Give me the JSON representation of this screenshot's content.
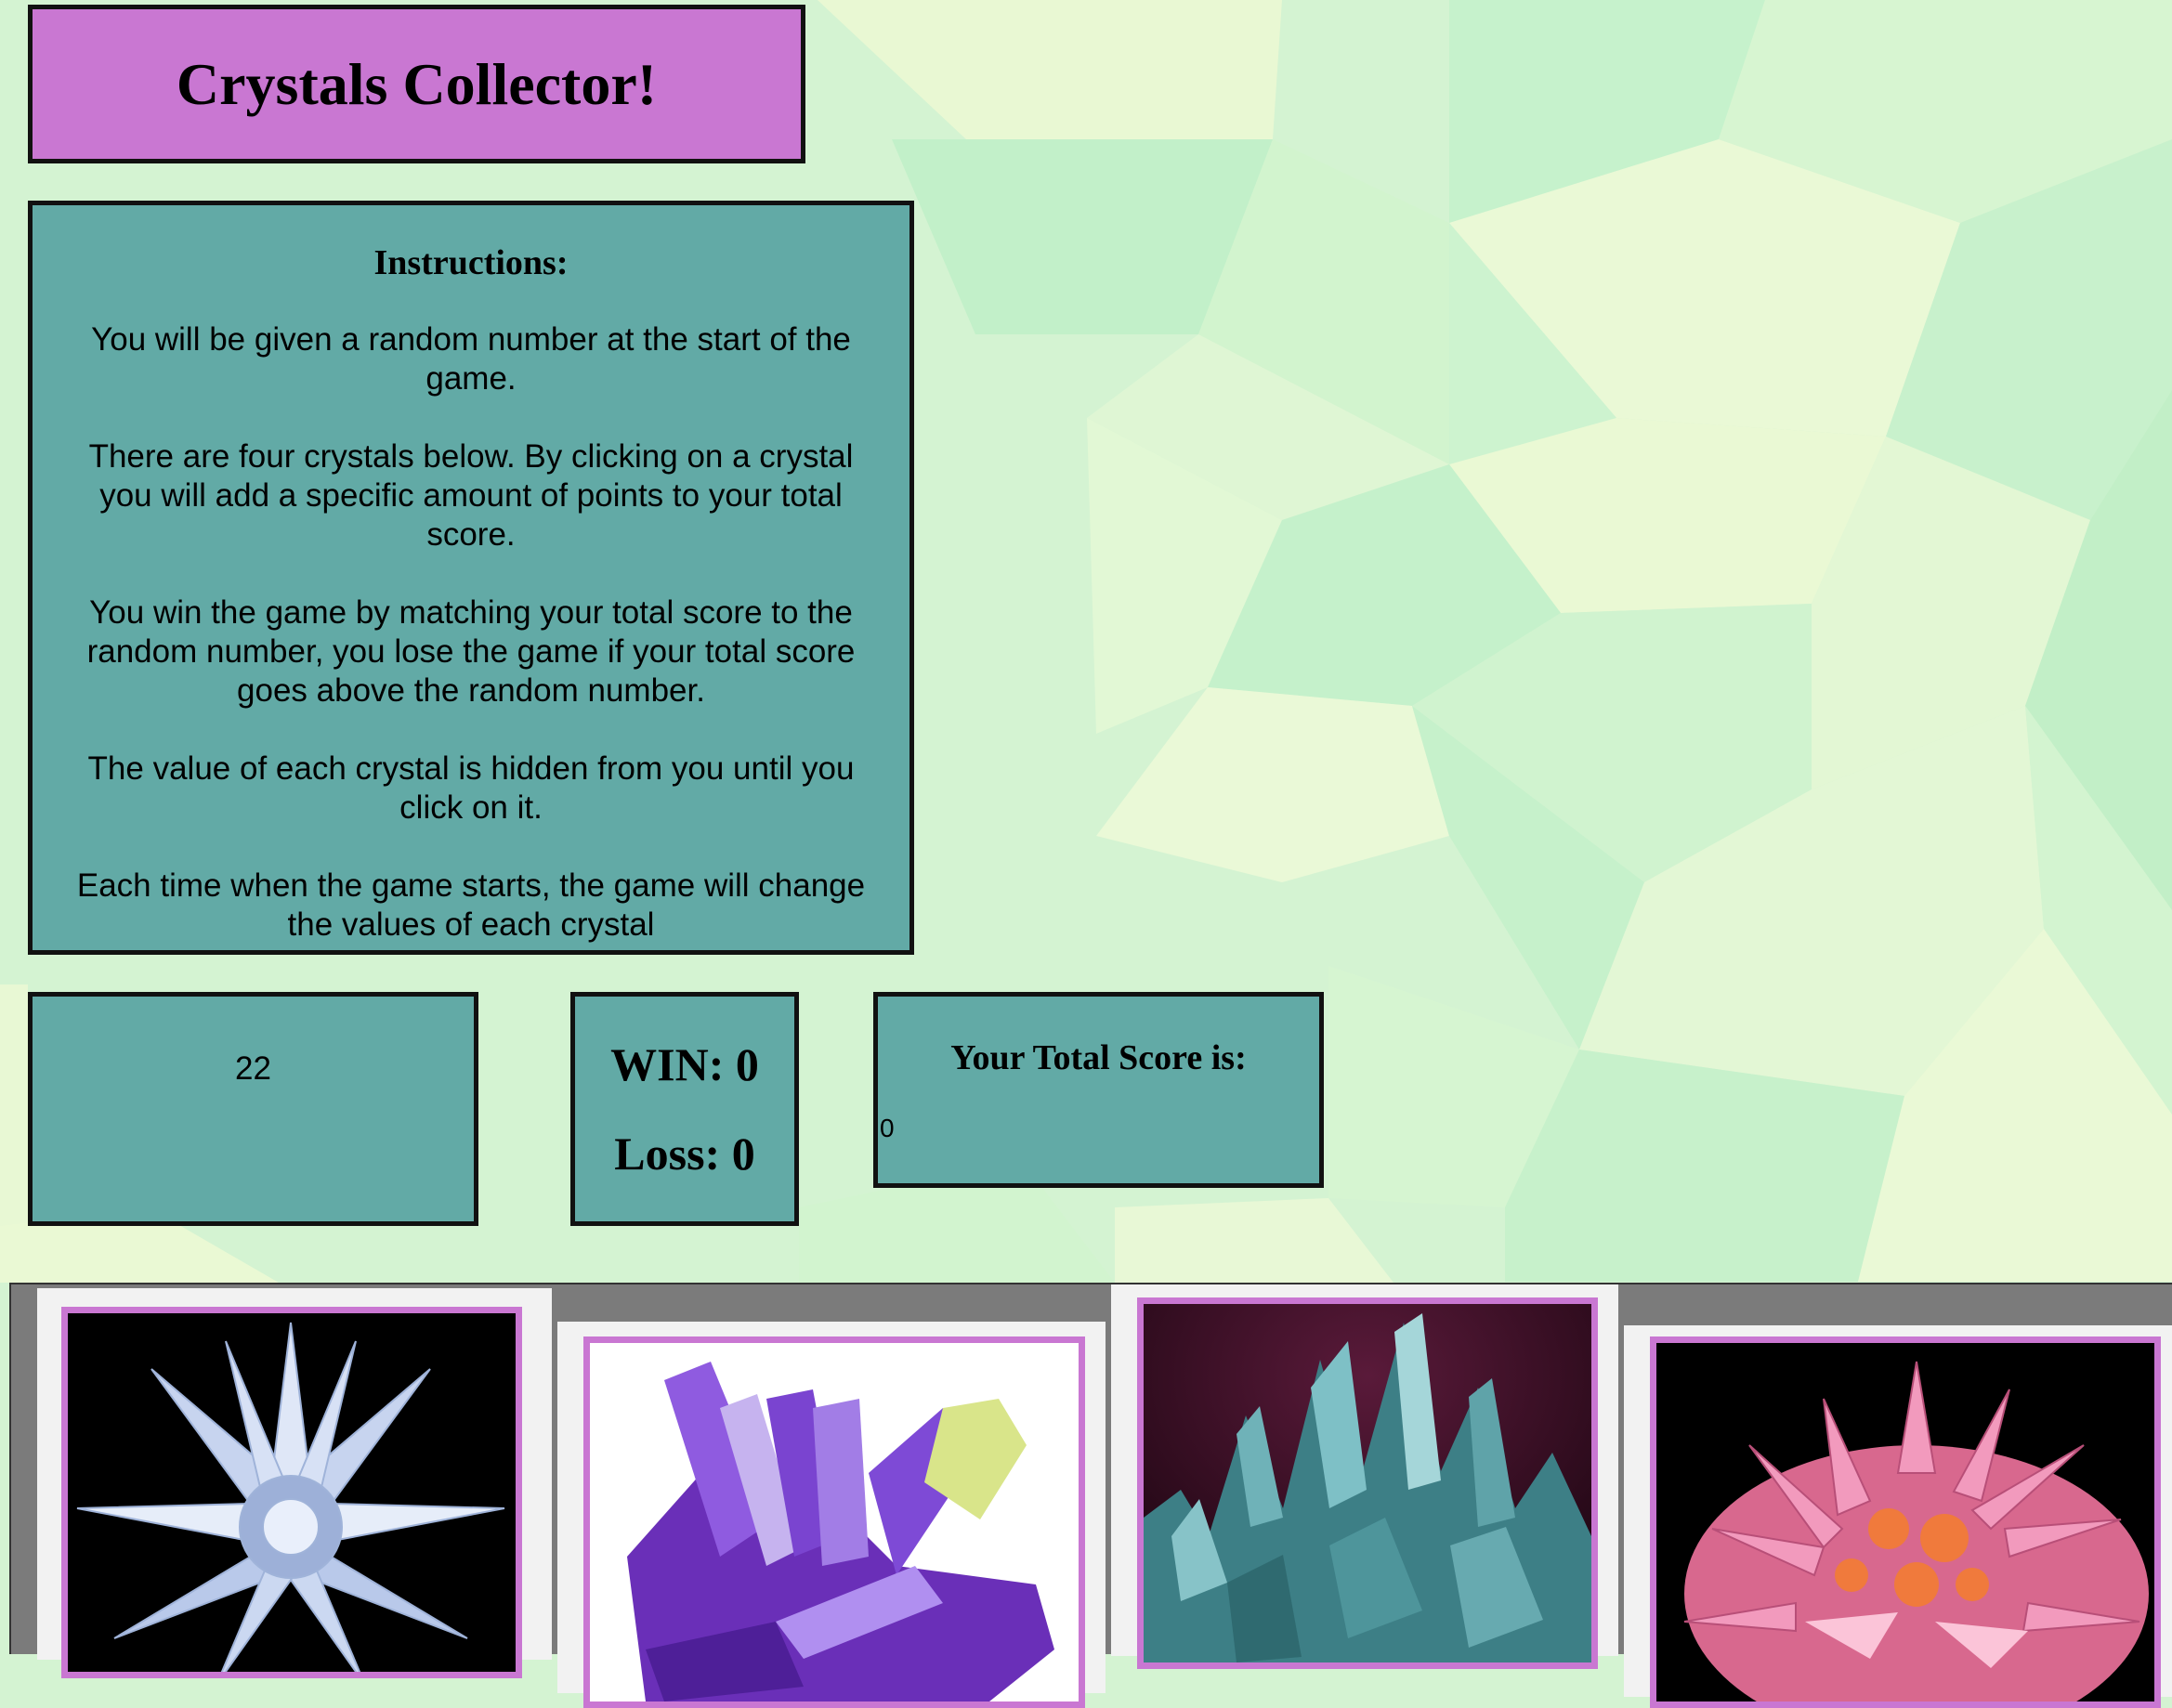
{
  "header": {
    "title": "Crystals Collector!"
  },
  "instructions": {
    "heading": "Instructions:",
    "paragraphs": [
      "You will be given a random number at the start of the game.",
      "There are four crystals below. By clicking on a crystal you will add a specific amount of points to your total score.",
      "You win the game by matching your total score to the random number, you lose the game if your total score goes above the random number.",
      "The value of each crystal is hidden from you until you click on it.",
      "Each time when the game starts, the game will change the values of each crystal"
    ]
  },
  "target": {
    "value": "22"
  },
  "record": {
    "win": "WIN: 0",
    "loss": "Loss: 0"
  },
  "score": {
    "heading": "Your Total Score is:",
    "value": "0"
  },
  "crystals": [
    {
      "icon": "clear-star-crystal-icon",
      "color": "#cfd8ef",
      "background": "#000000"
    },
    {
      "icon": "purple-amethyst-crystal-icon",
      "color": "#7a3fd1",
      "background": "#ffffff"
    },
    {
      "icon": "teal-aqua-crystal-icon",
      "color": "#4e9aa0",
      "background": "#2a0a1e"
    },
    {
      "icon": "pink-cluster-crystal-icon",
      "color": "#e47aa8",
      "background": "#000000"
    }
  ],
  "colors": {
    "title_bg": "#c977d2",
    "panel_bg": "#62aaa6",
    "crystal_border": "#c977d2",
    "page_bg": "#d4f3d2"
  }
}
